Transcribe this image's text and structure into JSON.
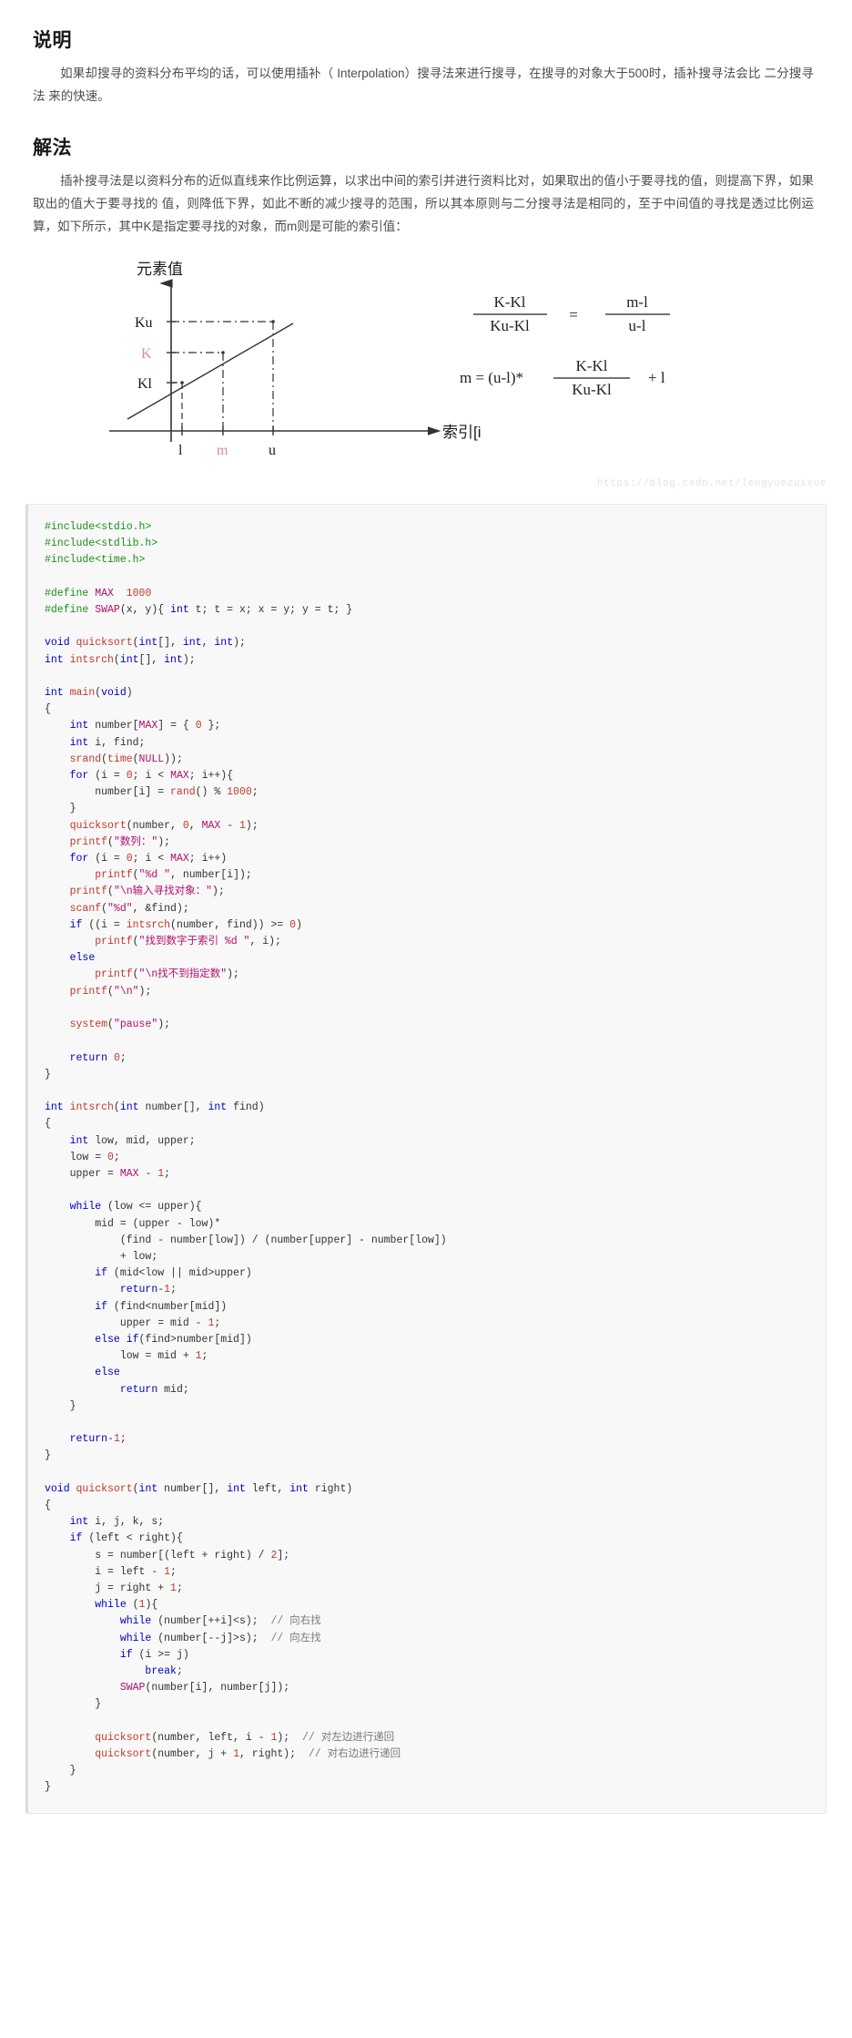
{
  "sections": [
    {
      "id": "explanation",
      "title": "说明",
      "paragraph": "如果却搜寻的资料分布平均的话，可以使用插补（ Interpolation）搜寻法来进行搜寻，在搜寻的对象大于500时，插补搜寻法会比 二分搜寻法 来的快速。"
    },
    {
      "id": "solution",
      "title": "解法",
      "paragraph": "插补搜寻法是以资料分布的近似直线来作比例运算，以求出中间的索引并进行资料比对，如果取出的值小于要寻找的值，则提高下界，如果取出的值大于要寻找的 值，则降低下界，如此不断的减少搜寻的范围，所以其本原则与二分搜寻法是相同的，至于中间值的寻找是透过比例运算，如下所示，其中K是指定要寻找的对象，而m则是可能的索引值："
    }
  ],
  "figure": {
    "name": "interpolation-search-diagram",
    "y_axis_label": "元素值",
    "x_axis_label": "索引[i",
    "y_ticks": [
      "Ku",
      "K",
      "Kl"
    ],
    "x_ticks": [
      "l",
      "m",
      "u"
    ],
    "highlight_color": "#e08a96",
    "axis_color": "#333333",
    "formula1": {
      "left_num": "K-Kl",
      "left_den": "Ku-Kl",
      "equals": "=",
      "right_num": "m-l",
      "right_den": "u-l"
    },
    "formula2": {
      "lhs": "m = (u-l)*",
      "frac_num": "K-Kl",
      "frac_den": "Ku-Kl",
      "tail": "+ l"
    },
    "watermark": "https://blog.csdn.net/lengyuezuixue"
  },
  "code": {
    "language": "c",
    "colors": {
      "keyword": "#0000c0",
      "preprocessor": "#1a8f1a",
      "macro": "#b0106c",
      "function": "#c0392b",
      "string": "#b0106c",
      "number": "#c0392b",
      "comment": "#7a7a7a",
      "background": "#f8f8f8"
    },
    "lines": [
      [
        {
          "t": "#include",
          "c": "pp"
        },
        {
          "t": "<stdio.h>",
          "c": "pp"
        }
      ],
      [
        {
          "t": "#include",
          "c": "pp"
        },
        {
          "t": "<stdlib.h>",
          "c": "pp"
        }
      ],
      [
        {
          "t": "#include",
          "c": "pp"
        },
        {
          "t": "<time.h>",
          "c": "pp"
        }
      ],
      [],
      [
        {
          "t": "#define ",
          "c": "pp"
        },
        {
          "t": "MAX",
          "c": "mc"
        },
        {
          "t": "  ",
          "c": "pl"
        },
        {
          "t": "1000",
          "c": "nm"
        }
      ],
      [
        {
          "t": "#define ",
          "c": "pp"
        },
        {
          "t": "SWAP",
          "c": "mc"
        },
        {
          "t": "(x, y){ ",
          "c": "pl"
        },
        {
          "t": "int",
          "c": "k"
        },
        {
          "t": " t; t = x; x = y; y = t; }",
          "c": "pl"
        }
      ],
      [],
      [
        {
          "t": "void ",
          "c": "k"
        },
        {
          "t": "quicksort",
          "c": "fn"
        },
        {
          "t": "(",
          "c": "pl"
        },
        {
          "t": "int",
          "c": "k"
        },
        {
          "t": "[], ",
          "c": "pl"
        },
        {
          "t": "int",
          "c": "k"
        },
        {
          "t": ", ",
          "c": "pl"
        },
        {
          "t": "int",
          "c": "k"
        },
        {
          "t": ");",
          "c": "pl"
        }
      ],
      [
        {
          "t": "int ",
          "c": "k"
        },
        {
          "t": "intsrch",
          "c": "fn"
        },
        {
          "t": "(",
          "c": "pl"
        },
        {
          "t": "int",
          "c": "k"
        },
        {
          "t": "[], ",
          "c": "pl"
        },
        {
          "t": "int",
          "c": "k"
        },
        {
          "t": ");",
          "c": "pl"
        }
      ],
      [],
      [
        {
          "t": "int ",
          "c": "k"
        },
        {
          "t": "main",
          "c": "fn"
        },
        {
          "t": "(",
          "c": "pl"
        },
        {
          "t": "void",
          "c": "k"
        },
        {
          "t": ")",
          "c": "pl"
        }
      ],
      [
        {
          "t": "{",
          "c": "pl"
        }
      ],
      [
        {
          "t": "    ",
          "c": "pl"
        },
        {
          "t": "int",
          "c": "k"
        },
        {
          "t": " number[",
          "c": "pl"
        },
        {
          "t": "MAX",
          "c": "mc"
        },
        {
          "t": "] = { ",
          "c": "pl"
        },
        {
          "t": "0",
          "c": "nm"
        },
        {
          "t": " };",
          "c": "pl"
        }
      ],
      [
        {
          "t": "    ",
          "c": "pl"
        },
        {
          "t": "int",
          "c": "k"
        },
        {
          "t": " i, find;",
          "c": "pl"
        }
      ],
      [
        {
          "t": "    ",
          "c": "pl"
        },
        {
          "t": "srand",
          "c": "fn"
        },
        {
          "t": "(",
          "c": "pl"
        },
        {
          "t": "time",
          "c": "fn"
        },
        {
          "t": "(",
          "c": "pl"
        },
        {
          "t": "NULL",
          "c": "mc"
        },
        {
          "t": "));",
          "c": "pl"
        }
      ],
      [
        {
          "t": "    ",
          "c": "pl"
        },
        {
          "t": "for",
          "c": "k"
        },
        {
          "t": " (i = ",
          "c": "pl"
        },
        {
          "t": "0",
          "c": "nm"
        },
        {
          "t": "; i < ",
          "c": "pl"
        },
        {
          "t": "MAX",
          "c": "mc"
        },
        {
          "t": "; i++){",
          "c": "pl"
        }
      ],
      [
        {
          "t": "        number[i] = ",
          "c": "pl"
        },
        {
          "t": "rand",
          "c": "fn"
        },
        {
          "t": "() % ",
          "c": "pl"
        },
        {
          "t": "1000",
          "c": "nm"
        },
        {
          "t": ";",
          "c": "pl"
        }
      ],
      [
        {
          "t": "    }",
          "c": "pl"
        }
      ],
      [
        {
          "t": "    ",
          "c": "pl"
        },
        {
          "t": "quicksort",
          "c": "fn"
        },
        {
          "t": "(number, ",
          "c": "pl"
        },
        {
          "t": "0",
          "c": "nm"
        },
        {
          "t": ", ",
          "c": "pl"
        },
        {
          "t": "MAX",
          "c": "mc"
        },
        {
          "t": " - ",
          "c": "pl"
        },
        {
          "t": "1",
          "c": "nm"
        },
        {
          "t": ");",
          "c": "pl"
        }
      ],
      [
        {
          "t": "    ",
          "c": "pl"
        },
        {
          "t": "printf",
          "c": "fn"
        },
        {
          "t": "(",
          "c": "pl"
        },
        {
          "t": "\"数列：\"",
          "c": "st"
        },
        {
          "t": ");",
          "c": "pl"
        }
      ],
      [
        {
          "t": "    ",
          "c": "pl"
        },
        {
          "t": "for",
          "c": "k"
        },
        {
          "t": " (i = ",
          "c": "pl"
        },
        {
          "t": "0",
          "c": "nm"
        },
        {
          "t": "; i < ",
          "c": "pl"
        },
        {
          "t": "MAX",
          "c": "mc"
        },
        {
          "t": "; i++)",
          "c": "pl"
        }
      ],
      [
        {
          "t": "        ",
          "c": "pl"
        },
        {
          "t": "printf",
          "c": "fn"
        },
        {
          "t": "(",
          "c": "pl"
        },
        {
          "t": "\"%d \"",
          "c": "st"
        },
        {
          "t": ", number[i]);",
          "c": "pl"
        }
      ],
      [
        {
          "t": "    ",
          "c": "pl"
        },
        {
          "t": "printf",
          "c": "fn"
        },
        {
          "t": "(",
          "c": "pl"
        },
        {
          "t": "\"\\n输入寻找对象：\"",
          "c": "st"
        },
        {
          "t": ");",
          "c": "pl"
        }
      ],
      [
        {
          "t": "    ",
          "c": "pl"
        },
        {
          "t": "scanf",
          "c": "fn"
        },
        {
          "t": "(",
          "c": "pl"
        },
        {
          "t": "\"%d\"",
          "c": "st"
        },
        {
          "t": ", &find);",
          "c": "pl"
        }
      ],
      [
        {
          "t": "    ",
          "c": "pl"
        },
        {
          "t": "if",
          "c": "k"
        },
        {
          "t": " ((i = ",
          "c": "pl"
        },
        {
          "t": "intsrch",
          "c": "fn"
        },
        {
          "t": "(number, find)) >= ",
          "c": "pl"
        },
        {
          "t": "0",
          "c": "nm"
        },
        {
          "t": ")",
          "c": "pl"
        }
      ],
      [
        {
          "t": "        ",
          "c": "pl"
        },
        {
          "t": "printf",
          "c": "fn"
        },
        {
          "t": "(",
          "c": "pl"
        },
        {
          "t": "\"找到数字于索引 %d \"",
          "c": "st"
        },
        {
          "t": ", i);",
          "c": "pl"
        }
      ],
      [
        {
          "t": "    ",
          "c": "pl"
        },
        {
          "t": "else",
          "c": "k"
        }
      ],
      [
        {
          "t": "        ",
          "c": "pl"
        },
        {
          "t": "printf",
          "c": "fn"
        },
        {
          "t": "(",
          "c": "pl"
        },
        {
          "t": "\"\\n找不到指定数\"",
          "c": "st"
        },
        {
          "t": ");",
          "c": "pl"
        }
      ],
      [
        {
          "t": "    ",
          "c": "pl"
        },
        {
          "t": "printf",
          "c": "fn"
        },
        {
          "t": "(",
          "c": "pl"
        },
        {
          "t": "\"\\n\"",
          "c": "st"
        },
        {
          "t": ");",
          "c": "pl"
        }
      ],
      [],
      [
        {
          "t": "    ",
          "c": "pl"
        },
        {
          "t": "system",
          "c": "fn"
        },
        {
          "t": "(",
          "c": "pl"
        },
        {
          "t": "\"pause\"",
          "c": "st"
        },
        {
          "t": ");",
          "c": "pl"
        }
      ],
      [],
      [
        {
          "t": "    ",
          "c": "pl"
        },
        {
          "t": "return",
          "c": "k"
        },
        {
          "t": " ",
          "c": "pl"
        },
        {
          "t": "0",
          "c": "nm"
        },
        {
          "t": ";",
          "c": "pl"
        }
      ],
      [
        {
          "t": "}",
          "c": "pl"
        }
      ],
      [],
      [
        {
          "t": "int ",
          "c": "k"
        },
        {
          "t": "intsrch",
          "c": "fn"
        },
        {
          "t": "(",
          "c": "pl"
        },
        {
          "t": "int",
          "c": "k"
        },
        {
          "t": " number[], ",
          "c": "pl"
        },
        {
          "t": "int",
          "c": "k"
        },
        {
          "t": " find)",
          "c": "pl"
        }
      ],
      [
        {
          "t": "{",
          "c": "pl"
        }
      ],
      [
        {
          "t": "    ",
          "c": "pl"
        },
        {
          "t": "int",
          "c": "k"
        },
        {
          "t": " low, mid, upper;",
          "c": "pl"
        }
      ],
      [
        {
          "t": "    low = ",
          "c": "pl"
        },
        {
          "t": "0",
          "c": "nm"
        },
        {
          "t": ";",
          "c": "pl"
        }
      ],
      [
        {
          "t": "    upper = ",
          "c": "pl"
        },
        {
          "t": "MAX",
          "c": "mc"
        },
        {
          "t": " - ",
          "c": "pl"
        },
        {
          "t": "1",
          "c": "nm"
        },
        {
          "t": ";",
          "c": "pl"
        }
      ],
      [],
      [
        {
          "t": "    ",
          "c": "pl"
        },
        {
          "t": "while",
          "c": "k"
        },
        {
          "t": " (low <= upper){",
          "c": "pl"
        }
      ],
      [
        {
          "t": "        mid = (upper - low)*",
          "c": "pl"
        }
      ],
      [
        {
          "t": "            (find - number[low]) / (number[upper] - number[low])",
          "c": "pl"
        }
      ],
      [
        {
          "t": "            + low;",
          "c": "pl"
        }
      ],
      [
        {
          "t": "        ",
          "c": "pl"
        },
        {
          "t": "if",
          "c": "k"
        },
        {
          "t": " (mid<low || mid>upper)",
          "c": "pl"
        }
      ],
      [
        {
          "t": "            ",
          "c": "pl"
        },
        {
          "t": "return",
          "c": "k"
        },
        {
          "t": "-",
          "c": "pl"
        },
        {
          "t": "1",
          "c": "nm"
        },
        {
          "t": ";",
          "c": "pl"
        }
      ],
      [
        {
          "t": "        ",
          "c": "pl"
        },
        {
          "t": "if",
          "c": "k"
        },
        {
          "t": " (find<number[mid])",
          "c": "pl"
        }
      ],
      [
        {
          "t": "            upper = mid - ",
          "c": "pl"
        },
        {
          "t": "1",
          "c": "nm"
        },
        {
          "t": ";",
          "c": "pl"
        }
      ],
      [
        {
          "t": "        ",
          "c": "pl"
        },
        {
          "t": "else if",
          "c": "k"
        },
        {
          "t": "(find>number[mid])",
          "c": "pl"
        }
      ],
      [
        {
          "t": "            low = mid + ",
          "c": "pl"
        },
        {
          "t": "1",
          "c": "nm"
        },
        {
          "t": ";",
          "c": "pl"
        }
      ],
      [
        {
          "t": "        ",
          "c": "pl"
        },
        {
          "t": "else",
          "c": "k"
        }
      ],
      [
        {
          "t": "            ",
          "c": "pl"
        },
        {
          "t": "return",
          "c": "k"
        },
        {
          "t": " mid;",
          "c": "pl"
        }
      ],
      [
        {
          "t": "    }",
          "c": "pl"
        }
      ],
      [],
      [
        {
          "t": "    ",
          "c": "pl"
        },
        {
          "t": "return",
          "c": "k"
        },
        {
          "t": "-",
          "c": "pl"
        },
        {
          "t": "1",
          "c": "nm"
        },
        {
          "t": ";",
          "c": "pl"
        }
      ],
      [
        {
          "t": "}",
          "c": "pl"
        }
      ],
      [],
      [
        {
          "t": "void ",
          "c": "k"
        },
        {
          "t": "quicksort",
          "c": "fn"
        },
        {
          "t": "(",
          "c": "pl"
        },
        {
          "t": "int",
          "c": "k"
        },
        {
          "t": " number[], ",
          "c": "pl"
        },
        {
          "t": "int",
          "c": "k"
        },
        {
          "t": " left, ",
          "c": "pl"
        },
        {
          "t": "int",
          "c": "k"
        },
        {
          "t": " right)",
          "c": "pl"
        }
      ],
      [
        {
          "t": "{",
          "c": "pl"
        }
      ],
      [
        {
          "t": "    ",
          "c": "pl"
        },
        {
          "t": "int",
          "c": "k"
        },
        {
          "t": " i, j, k, s;",
          "c": "pl"
        }
      ],
      [
        {
          "t": "    ",
          "c": "pl"
        },
        {
          "t": "if",
          "c": "k"
        },
        {
          "t": " (left < right){",
          "c": "pl"
        }
      ],
      [
        {
          "t": "        s = number[(left + right) / ",
          "c": "pl"
        },
        {
          "t": "2",
          "c": "nm"
        },
        {
          "t": "];",
          "c": "pl"
        }
      ],
      [
        {
          "t": "        i = left - ",
          "c": "pl"
        },
        {
          "t": "1",
          "c": "nm"
        },
        {
          "t": ";",
          "c": "pl"
        }
      ],
      [
        {
          "t": "        j = right + ",
          "c": "pl"
        },
        {
          "t": "1",
          "c": "nm"
        },
        {
          "t": ";",
          "c": "pl"
        }
      ],
      [
        {
          "t": "        ",
          "c": "pl"
        },
        {
          "t": "while",
          "c": "k"
        },
        {
          "t": " (",
          "c": "pl"
        },
        {
          "t": "1",
          "c": "nm"
        },
        {
          "t": "){",
          "c": "pl"
        }
      ],
      [
        {
          "t": "            ",
          "c": "pl"
        },
        {
          "t": "while",
          "c": "k"
        },
        {
          "t": " (number[++i]<s);  ",
          "c": "pl"
        },
        {
          "t": "// 向右找",
          "c": "cm"
        }
      ],
      [
        {
          "t": "            ",
          "c": "pl"
        },
        {
          "t": "while",
          "c": "k"
        },
        {
          "t": " (number[--j]>s);  ",
          "c": "pl"
        },
        {
          "t": "// 向左找",
          "c": "cm"
        }
      ],
      [
        {
          "t": "            ",
          "c": "pl"
        },
        {
          "t": "if",
          "c": "k"
        },
        {
          "t": " (i >= j)",
          "c": "pl"
        }
      ],
      [
        {
          "t": "                ",
          "c": "pl"
        },
        {
          "t": "break",
          "c": "k"
        },
        {
          "t": ";",
          "c": "pl"
        }
      ],
      [
        {
          "t": "            ",
          "c": "pl"
        },
        {
          "t": "SWAP",
          "c": "mc"
        },
        {
          "t": "(number[i], number[j]);",
          "c": "pl"
        }
      ],
      [
        {
          "t": "        }",
          "c": "pl"
        }
      ],
      [],
      [
        {
          "t": "        ",
          "c": "pl"
        },
        {
          "t": "quicksort",
          "c": "fn"
        },
        {
          "t": "(number, left, i - ",
          "c": "pl"
        },
        {
          "t": "1",
          "c": "nm"
        },
        {
          "t": ");  ",
          "c": "pl"
        },
        {
          "t": "// 对左边进行递回",
          "c": "cm"
        }
      ],
      [
        {
          "t": "        ",
          "c": "pl"
        },
        {
          "t": "quicksort",
          "c": "fn"
        },
        {
          "t": "(number, j + ",
          "c": "pl"
        },
        {
          "t": "1",
          "c": "nm"
        },
        {
          "t": ", right);  ",
          "c": "pl"
        },
        {
          "t": "// 对右边进行递回",
          "c": "cm"
        }
      ],
      [
        {
          "t": "    }",
          "c": "pl"
        }
      ],
      [
        {
          "t": "}",
          "c": "pl"
        }
      ]
    ]
  }
}
